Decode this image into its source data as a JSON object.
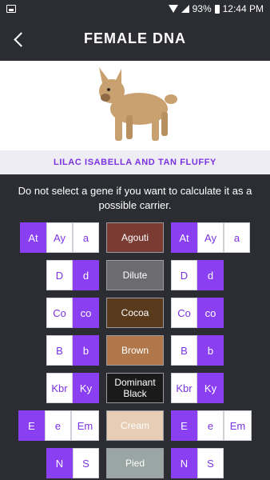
{
  "status": {
    "battery": "93%",
    "time": "12:44 PM"
  },
  "appbar": {
    "title": "FEMALE DNA"
  },
  "dog": {
    "name": "LILAC ISABELLA AND TAN FLUFFY"
  },
  "hint": "Do not select a gene if you want to calculate it as a possible carrier.",
  "colors": {
    "accent": "#8b3ff2",
    "background": "#2b2d33"
  },
  "genes": [
    {
      "label": "Agouti",
      "color": "#7a3b33",
      "left": [
        {
          "t": "At",
          "sel": true
        },
        {
          "t": "Ay",
          "sel": false
        },
        {
          "t": "a",
          "sel": false
        }
      ],
      "right": [
        {
          "t": "At",
          "sel": true
        },
        {
          "t": "Ay",
          "sel": false
        },
        {
          "t": "a",
          "sel": false
        }
      ]
    },
    {
      "label": "Dilute",
      "color": "#6c6c70",
      "left": [
        {
          "t": "D",
          "sel": false
        },
        {
          "t": "d",
          "sel": true
        }
      ],
      "right": [
        {
          "t": "D",
          "sel": false
        },
        {
          "t": "d",
          "sel": true
        }
      ]
    },
    {
      "label": "Cocoa",
      "color": "#5a3a1c",
      "left": [
        {
          "t": "Co",
          "sel": false
        },
        {
          "t": "co",
          "sel": true
        }
      ],
      "right": [
        {
          "t": "Co",
          "sel": false
        },
        {
          "t": "co",
          "sel": true
        }
      ]
    },
    {
      "label": "Brown",
      "color": "#b0784a",
      "left": [
        {
          "t": "B",
          "sel": false
        },
        {
          "t": "b",
          "sel": true
        }
      ],
      "right": [
        {
          "t": "B",
          "sel": false
        },
        {
          "t": "b",
          "sel": true
        }
      ]
    },
    {
      "label": "Dominant Black",
      "color": "#1a1a1a",
      "left": [
        {
          "t": "Kbr",
          "sel": false
        },
        {
          "t": "Ky",
          "sel": true
        }
      ],
      "right": [
        {
          "t": "Kbr",
          "sel": false
        },
        {
          "t": "Ky",
          "sel": true
        }
      ]
    },
    {
      "label": "Cream",
      "color": "#e6cdb4",
      "left": [
        {
          "t": "E",
          "sel": true
        },
        {
          "t": "e",
          "sel": false
        },
        {
          "t": "Em",
          "sel": false
        }
      ],
      "right": [
        {
          "t": "E",
          "sel": true
        },
        {
          "t": "e",
          "sel": false
        },
        {
          "t": "Em",
          "sel": false
        }
      ]
    },
    {
      "label": "Pied",
      "color": "#9aa6a3",
      "left": [
        {
          "t": "N",
          "sel": true
        },
        {
          "t": "S",
          "sel": false
        }
      ],
      "right": [
        {
          "t": "N",
          "sel": true
        },
        {
          "t": "S",
          "sel": false
        }
      ]
    }
  ]
}
